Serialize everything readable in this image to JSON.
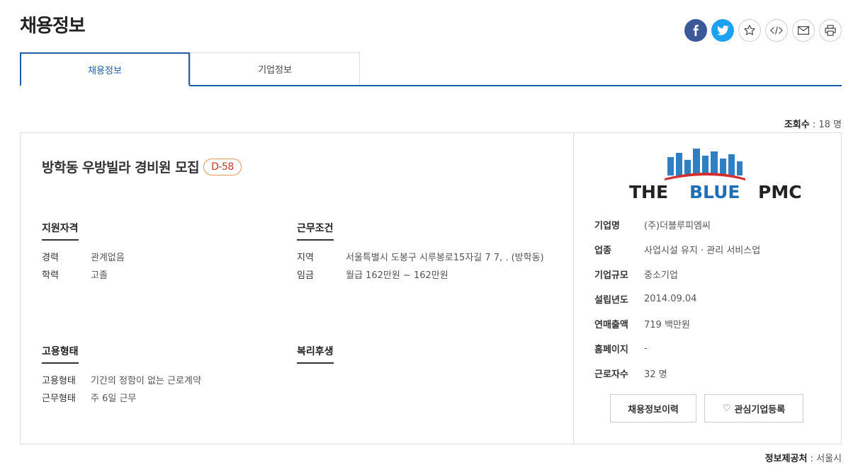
{
  "page": {
    "title": "채용정보"
  },
  "tabs": [
    {
      "label": "채용정보",
      "active": true
    },
    {
      "label": "기업정보",
      "active": false
    }
  ],
  "share_icons": [
    "facebook-icon",
    "twitter-icon",
    "star-icon",
    "embed-code-icon",
    "mail-icon",
    "print-icon"
  ],
  "views": {
    "label": "조회수",
    "separator": " : ",
    "value": "18 명"
  },
  "job": {
    "title": "방학동 우방빌라 경비원 모집",
    "dday": "D-58"
  },
  "qualification": {
    "heading": "지원자격",
    "rows": [
      {
        "key": "경력",
        "value": "관계없음"
      },
      {
        "key": "학력",
        "value": "고졸"
      }
    ]
  },
  "conditions": {
    "heading": "근무조건",
    "rows": [
      {
        "key": "지역",
        "value": "서울특별시 도봉구 시루봉로15자길 7 7, . (방학동)"
      },
      {
        "key": "임금",
        "value": "월급 162만원 ~ 162만원"
      }
    ]
  },
  "employment": {
    "heading": "고용형태",
    "rows": [
      {
        "key": "고용형태",
        "value": "기간의 정함이 없는 근로계약"
      },
      {
        "key": "근무형태",
        "value": "주 6일 근무"
      }
    ]
  },
  "welfare": {
    "heading": "복리후생"
  },
  "company": {
    "logo_text": [
      "THE",
      "BLUE",
      "PMC"
    ],
    "rows": [
      {
        "key": "기업명",
        "value": "(주)더블루피엠씨"
      },
      {
        "key": "업종",
        "value": "사업시설 유지 · 관리 서비스업"
      },
      {
        "key": "기업규모",
        "value": "중소기업"
      },
      {
        "key": "설립년도",
        "value": "2014.09.04"
      },
      {
        "key": "연매출액",
        "value": "719 백만원"
      },
      {
        "key": "홈페이지",
        "value": "-"
      },
      {
        "key": "근로자수",
        "value": "32 명"
      }
    ],
    "history_button": "채용정보이력",
    "favorite_button": "관심기업등록"
  },
  "provider": {
    "label": "정보제공처",
    "separator": " : ",
    "value": "서울시"
  },
  "colors": {
    "accent": "#1c5fa8",
    "facebook": "#3b5998",
    "twitter": "#1da1f2",
    "dday_border": "#e2955a"
  }
}
